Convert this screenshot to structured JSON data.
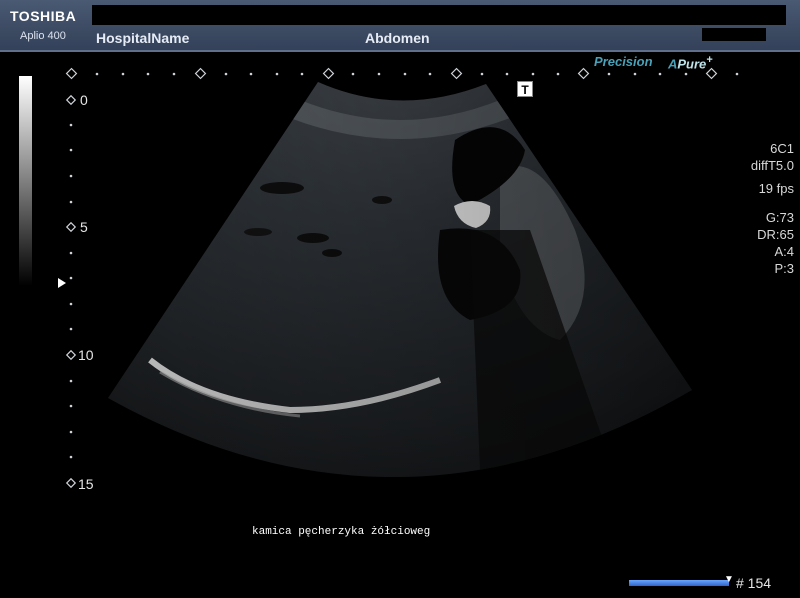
{
  "header": {
    "brand": "TOSHIBA",
    "model": "Aplio 400",
    "hospital": "HospitalName",
    "exam": "Abdomen"
  },
  "logos": {
    "precision": "Precision",
    "apure_a": "A",
    "apure_rest": "Pure",
    "apure_plus": "+"
  },
  "t_marker": "T",
  "params": {
    "probe": "6C1",
    "mode": "diffT5.0",
    "fps": "19 fps",
    "gain": "G:73",
    "dynamic_range": "DR:65",
    "a": "A:4",
    "p": "P:3"
  },
  "depth_scale": {
    "labels": [
      "0",
      "5",
      "10",
      "15"
    ]
  },
  "annotation": "kamica pęcherzyka żółcioweg",
  "cine": {
    "frame": "# 154",
    "progress": 1.0
  },
  "colors": {
    "header_bg": "#3c4a62",
    "logo_accent": "#4aa0b6",
    "cine_bar": "#2f64c8"
  }
}
